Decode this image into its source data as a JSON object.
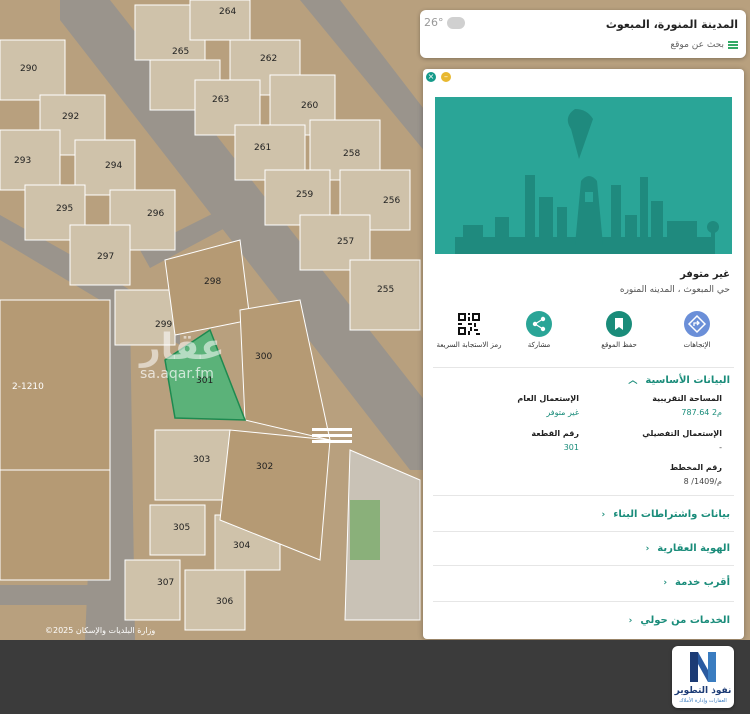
{
  "search": {
    "location_title": "المدينة المنورة، المبعوث",
    "hint": "بحث عن موقع",
    "temperature": "26°"
  },
  "map": {
    "parcels": [
      "264",
      "265",
      "262",
      "290",
      "263",
      "260",
      "292",
      "261",
      "258",
      "293",
      "294",
      "259",
      "256",
      "295",
      "296",
      "257",
      "297",
      "255",
      "298",
      "299",
      "300",
      "301",
      "303",
      "302",
      "305",
      "304",
      "307",
      "306"
    ],
    "block_label": "2-1210",
    "watermark": "عقار",
    "watermark_url": "sa.aqar.fm",
    "copyright": "©2025 وزارة البلديات والإسكان"
  },
  "panel": {
    "status": "غير متوفر",
    "location": "حي المبعوث ، المدينه المنوره",
    "actions": [
      {
        "label": "الإتجاهات",
        "icon": "directions-icon"
      },
      {
        "label": "حفظ الموقع",
        "icon": "bookmark-icon"
      },
      {
        "label": "مشاركة",
        "icon": "share-icon"
      },
      {
        "label": "رمز الاستجابة السريعة",
        "icon": "qr-code-icon"
      }
    ],
    "basic_data": {
      "title": "البيانات الأساسية",
      "fields": [
        {
          "label": "المساحة التقريبية",
          "value": "787.64 م2"
        },
        {
          "label": "الإستعمال العام",
          "value": "غير متوفر"
        },
        {
          "label": "الإستعمال التفصيلي",
          "value": "-"
        },
        {
          "label": "رقم القطعة",
          "value": "301"
        },
        {
          "label": "رقم المخطط",
          "value": "م/1409/ 8"
        }
      ]
    },
    "sections": [
      "بيانات واشتراطات البناء",
      "الهوية العقارية",
      "أقرب خدمة",
      "الخدمات من حولي"
    ]
  },
  "brand": {
    "title": "نفوذ التطوير",
    "subtitle": "العقارات وإدارة الأملاك"
  },
  "colors": {
    "accent": "#1a8c7a",
    "banner": "#2aa597",
    "selected_parcel": "#3cb878"
  }
}
